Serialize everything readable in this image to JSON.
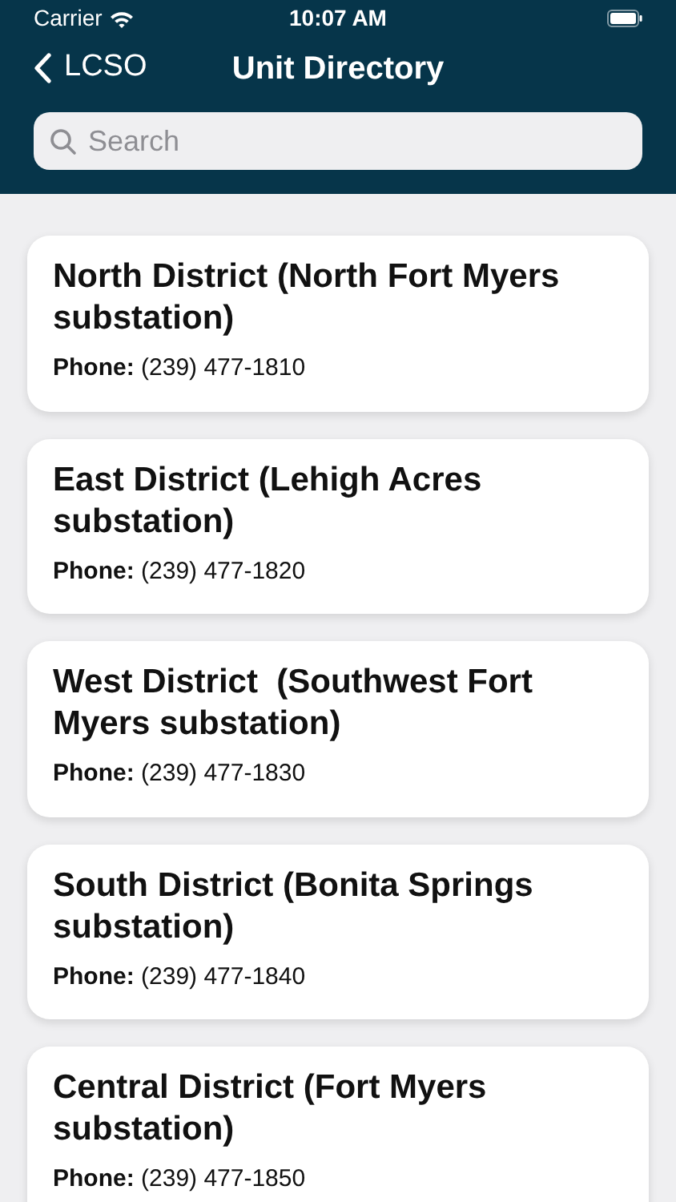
{
  "status_bar": {
    "carrier": "Carrier",
    "time": "10:07 AM"
  },
  "nav": {
    "back": "LCSO",
    "title": "Unit Directory"
  },
  "search": {
    "placeholder": "Search"
  },
  "units": [
    {
      "name": "North District (North Fort Myers substation)",
      "phone": "**Phone:** (239) 477-1810"
    },
    {
      "name": "East District (Lehigh Acres substation)",
      "phone": "**Phone:** (239) 477-1820"
    },
    {
      "name": "West District  (Southwest Fort Myers substation)",
      "phone": "**Phone:** (239) 477-1830"
    },
    {
      "name": "South District (Bonita Springs substation)",
      "phone": "**Phone:** (239) 477-1840"
    },
    {
      "name": "Central District (Fort Myers substation)",
      "phone": "**Phone:** (239) 477-1850"
    }
  ]
}
